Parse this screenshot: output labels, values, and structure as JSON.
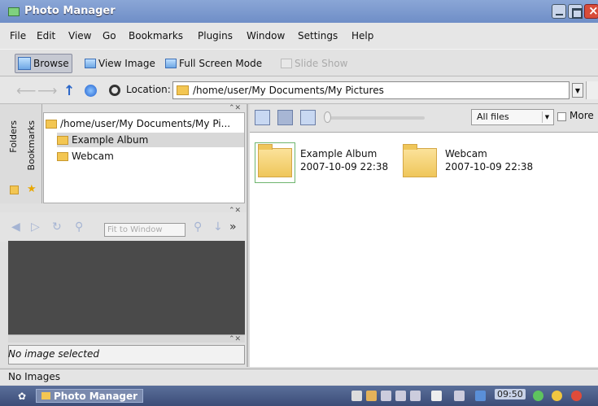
{
  "window": {
    "title": "Photo Manager"
  },
  "menu": [
    "File",
    "Edit",
    "View",
    "Go",
    "Bookmarks",
    "Plugins",
    "Window",
    "Settings",
    "Help"
  ],
  "toolbar": {
    "browse": "Browse",
    "view_image": "View Image",
    "full_screen": "Full Screen Mode",
    "slide_show": "Slide Show"
  },
  "location": {
    "label": "Location:",
    "path": "/home/user/My Documents/My Pictures"
  },
  "sidebar": {
    "tabs": [
      "Folders",
      "Bookmarks"
    ],
    "tree": [
      {
        "label": "/home/user/My Documents/My Pi..."
      },
      {
        "label": "Example Album"
      },
      {
        "label": "Webcam"
      }
    ],
    "fit_placeholder": "Fit to Window",
    "preview_status": "No image selected"
  },
  "browser": {
    "filter": "All files",
    "more_label": "More",
    "items": [
      {
        "name": "Example Album",
        "date": "2007-10-09 22:38"
      },
      {
        "name": "Webcam",
        "date": "2007-10-09 22:38"
      }
    ]
  },
  "statusbar": {
    "text": "No Images"
  },
  "taskbar": {
    "task": "Photo Manager",
    "clock": "09:50"
  },
  "colors": {
    "titlebar": "#7a97cc",
    "taskbar": "#4a5b86",
    "folder": "#f3c652",
    "preview_bg": "#4a4a4a"
  }
}
